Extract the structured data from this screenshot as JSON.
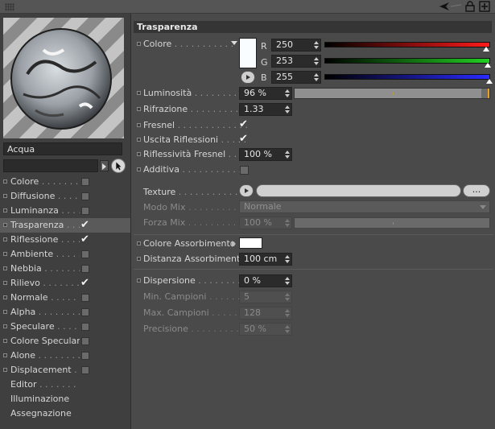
{
  "material": {
    "name": "Acqua"
  },
  "channels": [
    {
      "label": "Colore",
      "dots": " . . . . . . . ",
      "state": "box"
    },
    {
      "label": "Diffusione",
      "dots": " . . . . . .",
      "state": "box"
    },
    {
      "label": "Luminanza",
      "dots": " . . . . . .",
      "state": "box"
    },
    {
      "label": "Trasparenza",
      "dots": " . . .",
      "state": "check",
      "selected": true
    },
    {
      "label": "Riflessione",
      "dots": " . . . . .",
      "state": "check"
    },
    {
      "label": "Ambiente",
      "dots": " . . . . . . .",
      "state": "box"
    },
    {
      "label": "Nebbia",
      "dots": " . . . . . . . .",
      "state": "box"
    },
    {
      "label": "Rilievo",
      "dots": " . . . . . . . .",
      "state": "check"
    },
    {
      "label": "Normale",
      "dots": " . . . . . . .",
      "state": "box"
    },
    {
      "label": "Alpha",
      "dots": " . . . . . . . . .",
      "state": "box"
    },
    {
      "label": "Speculare",
      "dots": " . . . . . .",
      "state": "box"
    },
    {
      "label": "Colore Speculare",
      "dots": "",
      "state": "box"
    },
    {
      "label": "Alone",
      "dots": " . . . . . . . . .",
      "state": "box"
    },
    {
      "label": "Displacement",
      "dots": " . . .",
      "state": "box"
    },
    {
      "label": "Editor",
      "dots": " . . . . . . . . .",
      "state": "none"
    },
    {
      "label": "Illuminazione",
      "dots": "",
      "state": "none"
    },
    {
      "label": "Assegnazione",
      "dots": "",
      "state": "none"
    }
  ],
  "section": {
    "title": "Trasparenza"
  },
  "colore": {
    "label": "Colore",
    "dots": " . . . . . . . . . . .",
    "r_label": "R",
    "g_label": "G",
    "b_label": "B",
    "r": "250",
    "g": "253",
    "b": "255",
    "r_frac": 0.98,
    "g_frac": 0.99,
    "b_frac": 1.0,
    "swatch": "#fafdff"
  },
  "luminosita": {
    "label": "Luminosità",
    "dots": " . . . . . . . . .",
    "value": "96 %",
    "frac": 0.96
  },
  "rifrazione": {
    "label": "Rifrazione",
    "dots": " . . . . . . . . . .",
    "value": "1.33"
  },
  "fresnel": {
    "label": "Fresnel",
    "dots": " . . . . . . . . . . . . ."
  },
  "uscita": {
    "label": "Uscita Riflessioni",
    "dots": " . . . . ."
  },
  "riflessivita": {
    "label": "Riflessività Fresnel",
    "dots": " . . . .",
    "value": "100 %"
  },
  "additiva": {
    "label": "Additiva",
    "dots": " . . . . . . . . . . . ."
  },
  "texture": {
    "label": "Texture",
    "dots": " . . . . . . . . . . .",
    "ellipsis": "..."
  },
  "modo_mix": {
    "label": "Modo Mix",
    "dots": " . . . . . . . . . .",
    "value": "Normale"
  },
  "forza_mix": {
    "label": "Forza Mix",
    "dots": " . . . . . . . . . .",
    "value": "100 %"
  },
  "colore_assorbimento": {
    "label": "Colore Assorbimento",
    "swatch": "#ffffff"
  },
  "distanza_assorbimento": {
    "label": "Distanza Assorbimento",
    "value": "100 cm"
  },
  "dispersione": {
    "label": "Dispersione",
    "dots": " . . . . . . . . .",
    "value": "0 %"
  },
  "min_campioni": {
    "label": "Min. Campioni",
    "dots": " . . . . . . .",
    "value": "5"
  },
  "max_campioni": {
    "label": "Max. Campioni",
    "dots": " . . . . . . .",
    "value": "128"
  },
  "precisione": {
    "label": "Precisione",
    "dots": " . . . . . . . . . .",
    "value": "50 %"
  },
  "icons": [
    "arrow-back-icon",
    "lock-icon",
    "new-window-icon"
  ]
}
